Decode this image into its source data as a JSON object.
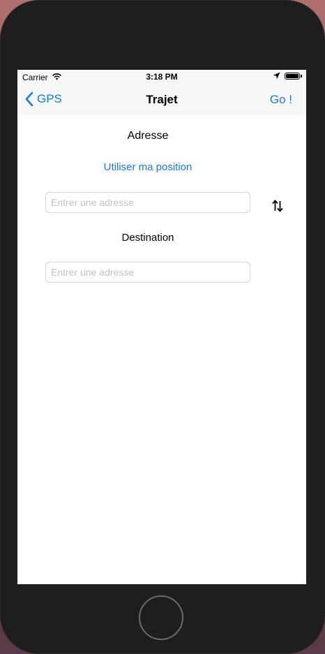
{
  "status_bar": {
    "carrier": "Carrier",
    "time": "3:18 PM",
    "wifi_icon": "wifi-icon",
    "location_icon": "location-arrow-icon",
    "battery_icon": "battery-full-icon"
  },
  "nav": {
    "back_label": "GPS",
    "title": "Trajet",
    "go_label": "Go !"
  },
  "form": {
    "origin_label": "Adresse",
    "use_position_label": "Utiliser ma position",
    "origin_placeholder": "Entrer une adresse",
    "origin_value": "",
    "swap_icon": "swap-vertical-icon",
    "destination_label": "Destination",
    "destination_placeholder": "Entrer une adresse",
    "destination_value": ""
  },
  "colors": {
    "accent": "#1a7ae6",
    "bar_background": "#f7f7f7",
    "device_frame": "#1e1e1e"
  }
}
